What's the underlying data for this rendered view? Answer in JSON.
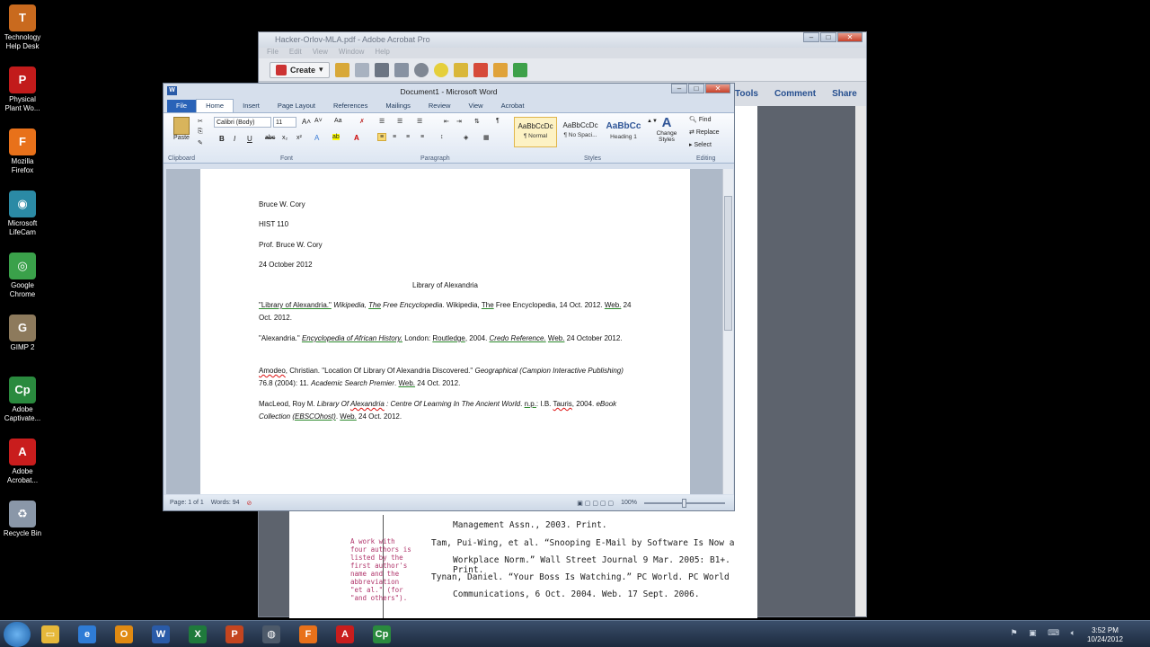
{
  "desktop": {
    "icons": [
      {
        "label": "Technology Help Desk",
        "color": "#c96a1e",
        "glyph": "T"
      },
      {
        "label": "Physical Plant Wo...",
        "color": "#c21b1b",
        "glyph": "P"
      },
      {
        "label": "Mozilla Firefox",
        "color": "#e8711a",
        "glyph": "F"
      },
      {
        "label": "Microsoft LifeCam",
        "color": "#2b8aa5",
        "glyph": "◉"
      },
      {
        "label": "Google Chrome",
        "color": "#3aa14a",
        "glyph": "◎"
      },
      {
        "label": "GIMP 2",
        "color": "#8d7a5c",
        "glyph": "G"
      },
      {
        "label": "Adobe Captivate...",
        "color": "#2a8a3e",
        "glyph": "Cp"
      },
      {
        "label": "Adobe Acrobat...",
        "color": "#c91d1d",
        "glyph": "A"
      },
      {
        "label": "Recycle Bin",
        "color": "#8a97a8",
        "glyph": "♻"
      }
    ]
  },
  "acrobat": {
    "title": "Hacker-Orlov-MLA.pdf - Adobe Acrobat Pro",
    "menu": [
      "File",
      "Edit",
      "View",
      "Window",
      "Help"
    ],
    "create_label": "Create",
    "panels": [
      "Tools",
      "Comment",
      "Share"
    ],
    "visible_lines": [
      "Management Assn., 2003. Print.",
      "Tam, Pui-Wing, et al. “Snooping E-Mail by Software Is Now a",
      "Workplace Norm.” Wall Street Journal 9 Mar. 2005: B1+. Print.",
      "Tynan, Daniel. “Your Boss Is Watching.” PC World. PC World",
      "Communications, 6 Oct. 2004. Web. 17 Sept. 2006."
    ],
    "annotation": "A work with four authors is listed by the first author's name and the abbreviation \"et al.\" (for \"and others\")."
  },
  "word": {
    "title": "Document1 - Microsoft Word",
    "tabs": [
      "File",
      "Home",
      "Insert",
      "Page Layout",
      "References",
      "Mailings",
      "Review",
      "View",
      "Acrobat"
    ],
    "font_name": "Calibri (Body)",
    "font_size": "11",
    "groups": [
      "Clipboard",
      "Font",
      "Paragraph",
      "Styles",
      "Editing"
    ],
    "styles": [
      {
        "preview": "AaBbCcDc",
        "name": "¶ Normal"
      },
      {
        "preview": "AaBbCcDc",
        "name": "¶ No Spaci..."
      },
      {
        "preview": "AaBbCc",
        "name": "Heading 1"
      }
    ],
    "change_styles": "Change Styles",
    "editing": [
      "Find",
      "Replace",
      "Select"
    ],
    "paste": "Paste",
    "document": {
      "header_lines": [
        "Bruce W. Cory",
        "HIST 110",
        "Prof. Bruce W. Cory",
        "24 October 2012"
      ],
      "heading": "Library of Alexandria"
    },
    "status": {
      "page": "Page: 1 of 1",
      "words": "Words: 94",
      "zoom": "100%"
    }
  },
  "taskbar": {
    "apps": [
      {
        "name": "explorer",
        "color": "#e6b83a",
        "glyph": "▭"
      },
      {
        "name": "ie",
        "color": "#2f7cd6",
        "glyph": "e"
      },
      {
        "name": "outlook",
        "color": "#e08a12",
        "glyph": "O"
      },
      {
        "name": "word",
        "color": "#2a5ba8",
        "glyph": "W"
      },
      {
        "name": "excel",
        "color": "#1f7a3c",
        "glyph": "X"
      },
      {
        "name": "powerpoint",
        "color": "#c4451f",
        "glyph": "P"
      },
      {
        "name": "steam",
        "color": "#4d5a6a",
        "glyph": "◍"
      },
      {
        "name": "firefox",
        "color": "#e8711a",
        "glyph": "F"
      },
      {
        "name": "acrobat",
        "color": "#c91d1d",
        "glyph": "A"
      },
      {
        "name": "captivate",
        "color": "#2a8a3e",
        "glyph": "Cp"
      }
    ],
    "time": "3:52 PM",
    "date": "10/24/2012"
  }
}
